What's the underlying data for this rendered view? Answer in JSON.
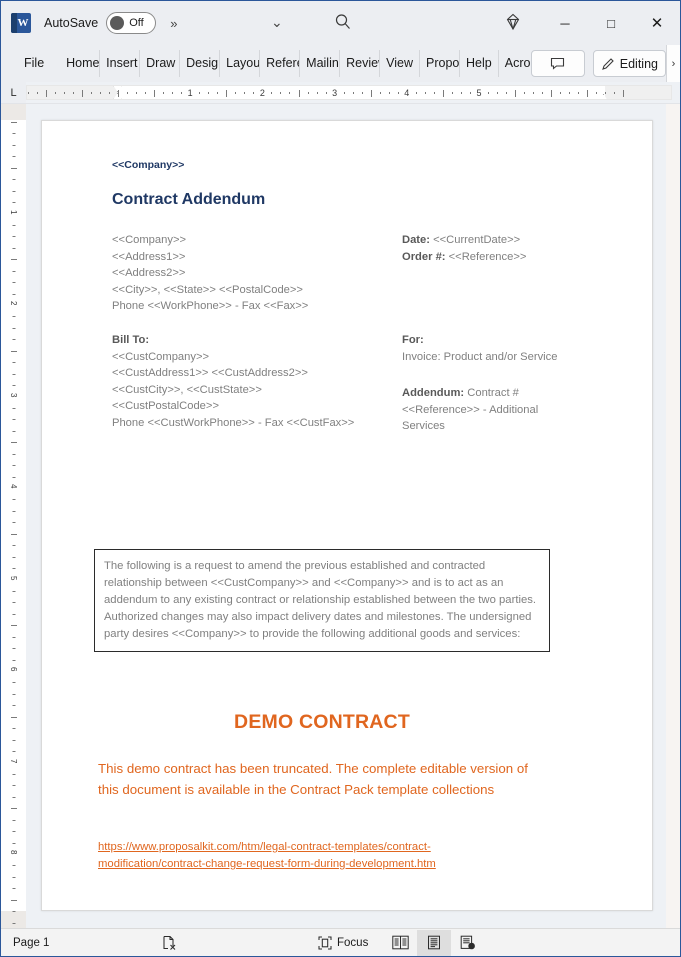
{
  "titlebar": {
    "autosave_label": "AutoSave",
    "autosave_state": "Off",
    "more_commands": "»",
    "customize_chevron": "⌄",
    "search_icon": "search-icon",
    "diamond_icon": "diamond-icon",
    "minimize": "─",
    "maximize": "□",
    "close": "✕",
    "word_logo_letter": "W"
  },
  "ribbon": {
    "tabs": [
      {
        "label": "File"
      },
      {
        "label": "Home"
      },
      {
        "label": "Insert"
      },
      {
        "label": "Draw"
      },
      {
        "label": "Design"
      },
      {
        "label": "Layout"
      },
      {
        "label": "References"
      },
      {
        "label": "Mailings"
      },
      {
        "label": "Review"
      },
      {
        "label": "View"
      },
      {
        "label": "Proposal Kit"
      },
      {
        "label": "Help"
      },
      {
        "label": "Acrobat"
      }
    ],
    "comment_button": "comment-icon",
    "editing_label": "Editing",
    "editing_icon": "pencil-icon",
    "expand_chevron": "›"
  },
  "ruler": {
    "tab_stop_marker": "L",
    "horizontal_numbers": [
      "1",
      "2",
      "3",
      "4",
      "5"
    ],
    "vertical_numbers": [
      "1",
      "2",
      "3",
      "4",
      "5",
      "6",
      "7",
      "8"
    ]
  },
  "document": {
    "company_header": "<<Company>>",
    "title": "Contract Addendum",
    "sender_address": [
      "<<Company>>",
      "<<Address1>>",
      "<<Address2>>",
      "<<City>>, <<State>>  <<PostalCode>>",
      "Phone <<WorkPhone>>  - Fax <<Fax>>"
    ],
    "meta": {
      "date_label": "Date:",
      "date_value": "<<CurrentDate>>",
      "order_label": "Order #:",
      "order_value": "<<Reference>>"
    },
    "bill_to": {
      "heading": "Bill To:",
      "lines": [
        "<<CustCompany>>",
        "<<CustAddress1>> <<CustAddress2>>",
        "<<CustCity>>, <<CustState>>",
        "<<CustPostalCode>>",
        "Phone <<CustWorkPhone>>  - Fax <<CustFax>>"
      ]
    },
    "for_block": {
      "heading": "For:",
      "line": "Invoice: Product and/or Service",
      "addendum_label": "Addendum:",
      "addendum_value": "Contract #<<Reference>> - Additional Services"
    },
    "boxed_paragraph": "The following is a request to amend the previous established and contracted relationship between <<CustCompany>> and <<Company>> and is to act as an addendum to any existing contract or relationship established between the two parties. Authorized changes may also impact delivery dates and milestones.  The undersigned party desires <<Company>> to provide the following additional goods and services:",
    "demo_title": "DEMO CONTRACT",
    "demo_body": "This demo contract has been truncated. The complete editable version of this document is available in the Contract Pack template collections",
    "demo_link": "https://www.proposalkit.com/htm/legal-contract-templates/contract-modification/contract-change-request-form-during-development.htm"
  },
  "statusbar": {
    "page_label": "Page 1",
    "proofing_icon": "proofing-errors-icon",
    "focus_label": "Focus",
    "focus_icon": "focus-icon",
    "view_read_icon": "read-mode-icon",
    "view_print_icon": "print-layout-icon",
    "view_web_icon": "web-layout-icon"
  },
  "colors": {
    "accent_navy": "#1f3864",
    "demo_orange": "#e0661f",
    "body_gray": "#808080",
    "window_border": "#2b579a"
  }
}
